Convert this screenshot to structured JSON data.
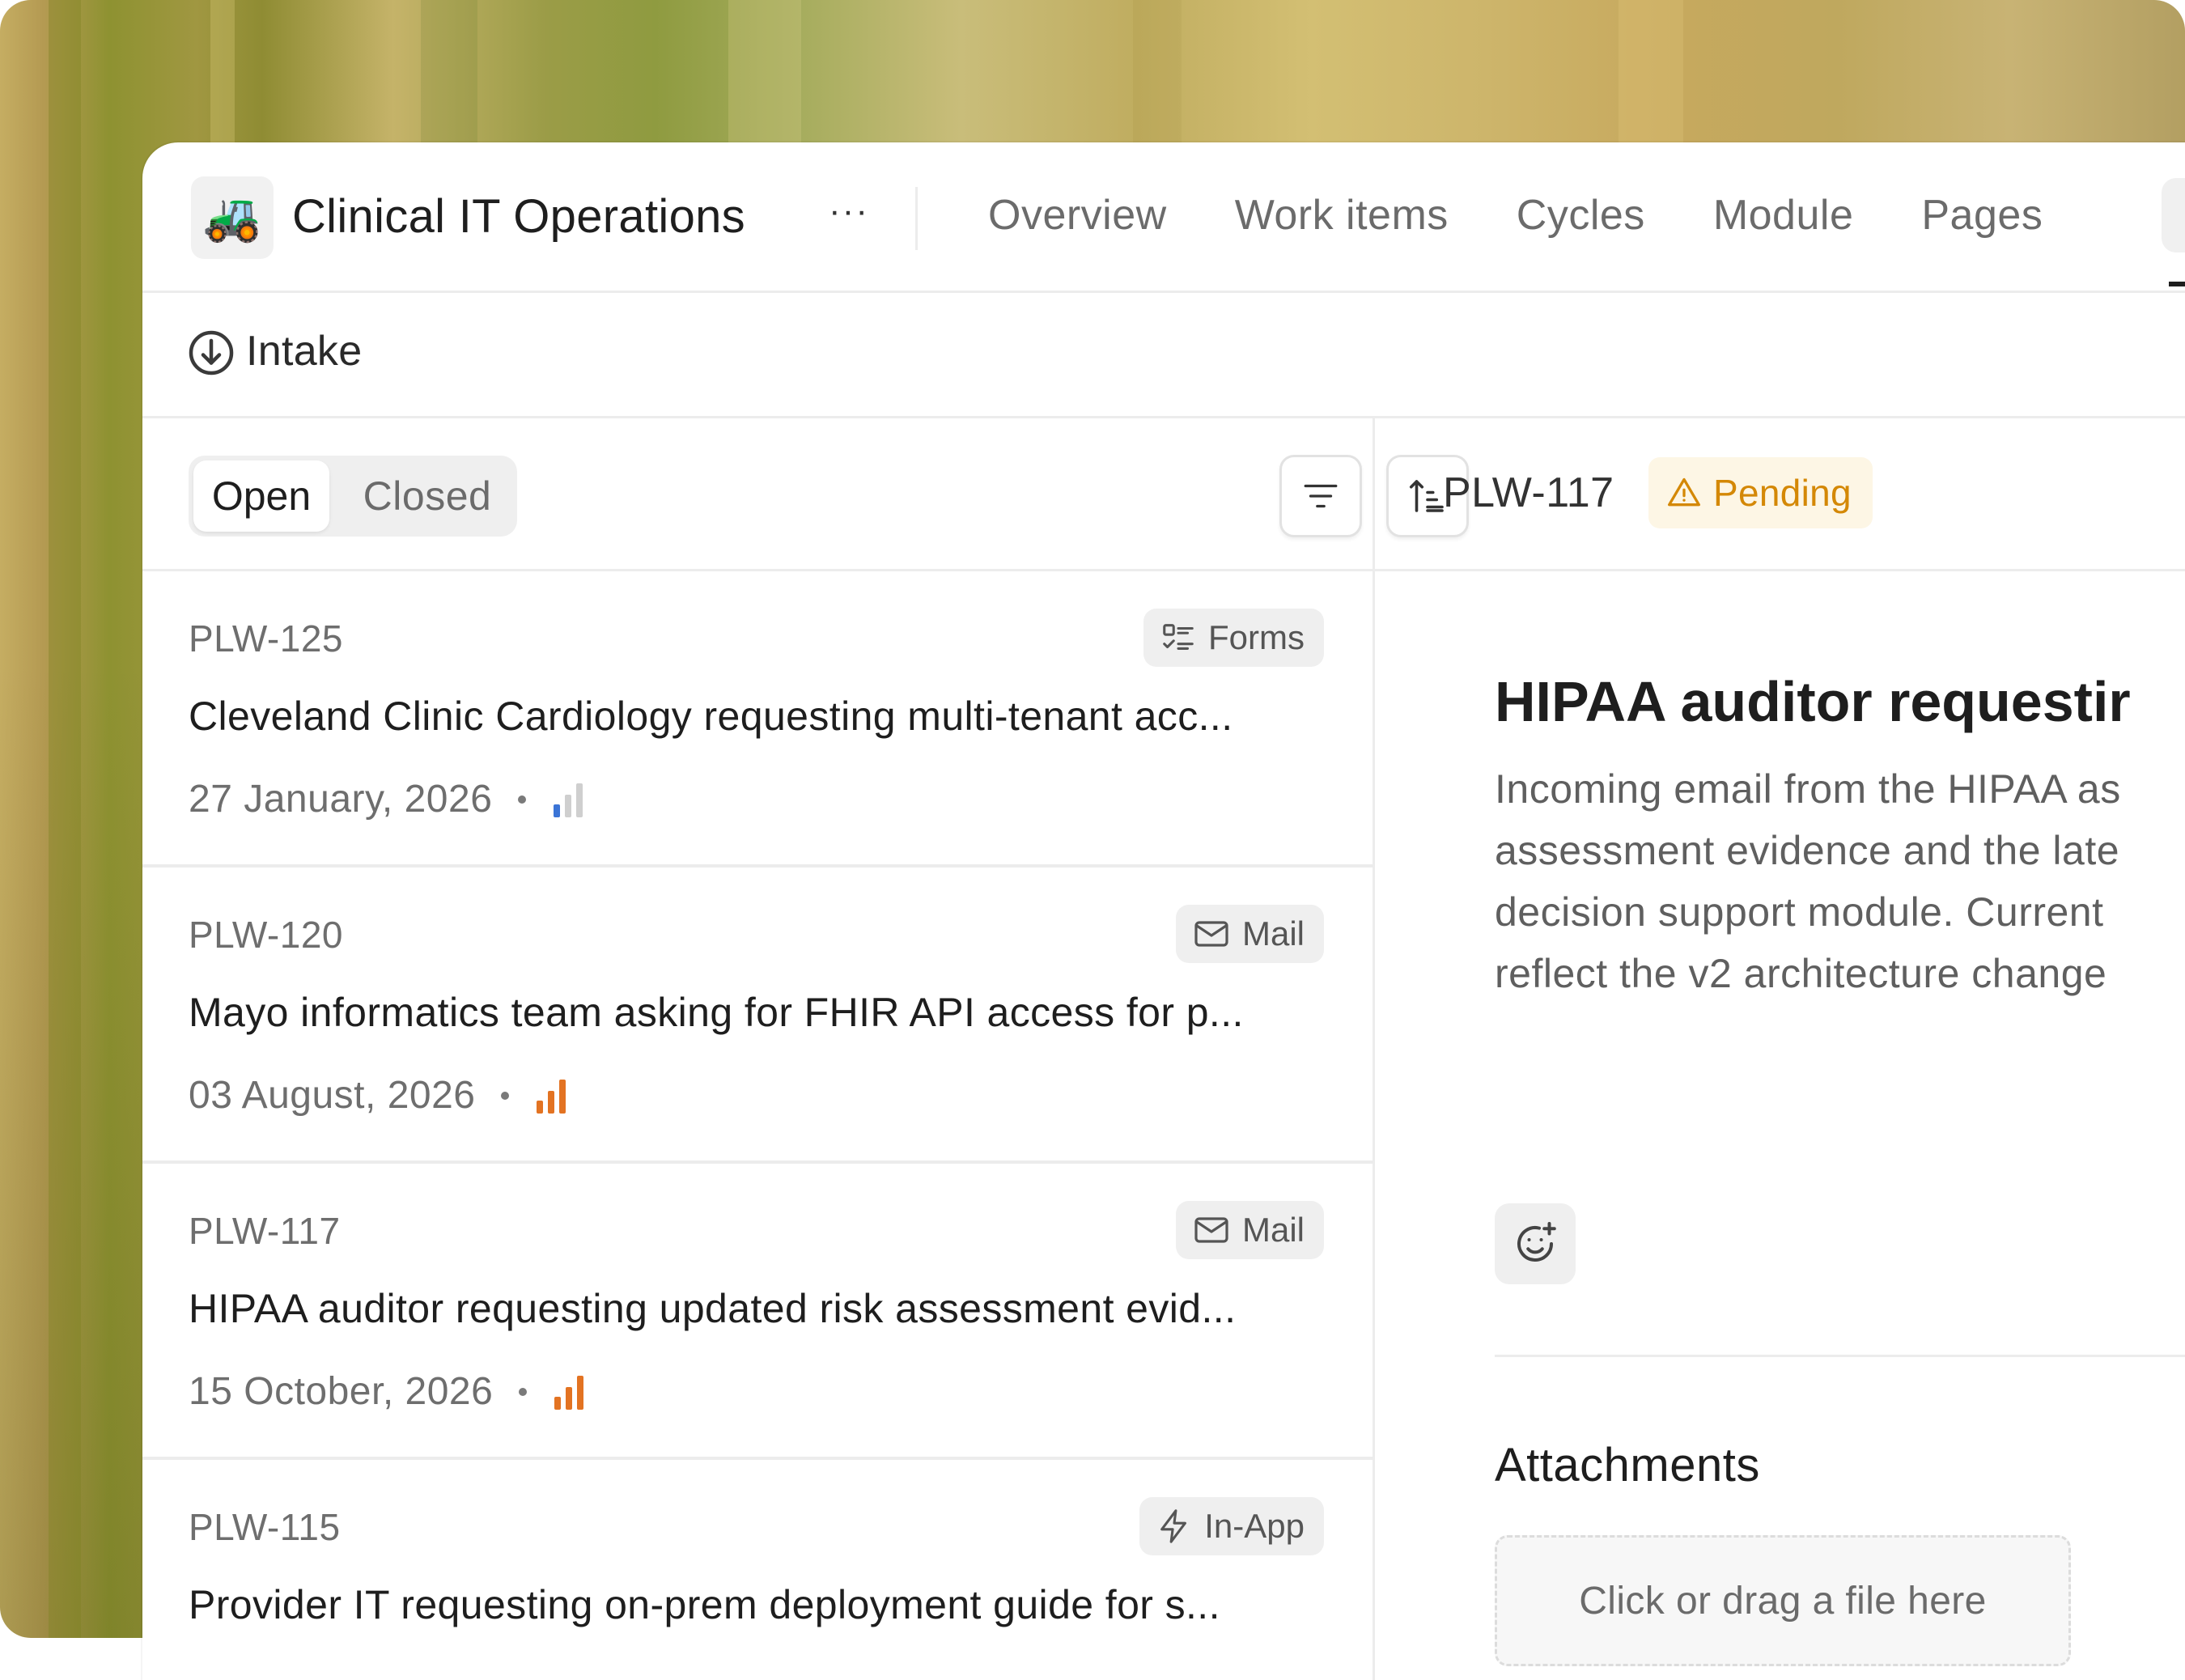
{
  "project": {
    "icon": "tractor-emoji",
    "icon_glyph": "🚜",
    "name": "Clinical IT Operations",
    "more": "···"
  },
  "nav": {
    "items": [
      "Overview",
      "Work items",
      "Cycles",
      "Module",
      "Pages"
    ],
    "active": "In"
  },
  "intake": {
    "label": "Intake",
    "icon": "intake-arrow-circle-icon"
  },
  "filters": {
    "open": "Open",
    "closed": "Closed",
    "filter_icon": "filter-lines-icon",
    "sort_icon": "sort-ascending-icon"
  },
  "list": [
    {
      "id": "PLW-125",
      "source": "Forms",
      "source_icon": "forms-icon",
      "title": "Cleveland Clinic Cardiology requesting multi-tenant acc...",
      "date": "27 January, 2026",
      "priority": "low",
      "priority_color": "#3b74d6"
    },
    {
      "id": "PLW-120",
      "source": "Mail",
      "source_icon": "mail-icon",
      "title": "Mayo informatics team asking for FHIR API access for p...",
      "date": "03 August, 2026",
      "priority": "high",
      "priority_color": "#e37322"
    },
    {
      "id": "PLW-117",
      "source": "Mail",
      "source_icon": "mail-icon",
      "title": "HIPAA auditor requesting updated risk assessment evid...",
      "date": "15 October, 2026",
      "priority": "high",
      "priority_color": "#e37322"
    },
    {
      "id": "PLW-115",
      "source": "In-App",
      "source_icon": "lightning-icon",
      "title": "Provider IT requesting on-prem deployment guide for s..."
    }
  ],
  "detail": {
    "id": "PLW-117",
    "status": "Pending",
    "status_color": "#d48806",
    "title": "HIPAA auditor requestir",
    "body_lines": [
      "Incoming email from the HIPAA as",
      "assessment evidence and the late",
      "decision support module. Current",
      "reflect the v2 architecture change"
    ],
    "emoji_icon": "add-reaction-icon",
    "attachments_title": "Attachments",
    "dropzone_text": "Click or drag a file here"
  }
}
